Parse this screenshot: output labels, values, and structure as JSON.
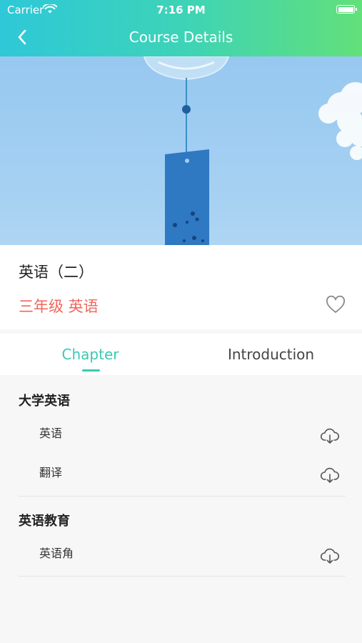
{
  "status_bar": {
    "carrier": "Carrier",
    "time": "7:16 PM"
  },
  "nav": {
    "title": "Course Details"
  },
  "course": {
    "title": "英语（二）",
    "subtitle": "三年级 英语"
  },
  "tabs": [
    {
      "label": "Chapter",
      "active": true
    },
    {
      "label": "Introduction",
      "active": false
    }
  ],
  "chapters": [
    {
      "title": "大学英语",
      "lessons": [
        {
          "title": "英语"
        },
        {
          "title": "翻译"
        }
      ]
    },
    {
      "title": "英语教育",
      "lessons": [
        {
          "title": "英语角"
        }
      ]
    }
  ],
  "colors": {
    "header_gradient": [
      "#2ec8d8",
      "#62e07a"
    ],
    "accent": "#3ac9b3",
    "subtitle_red": "#f0665c"
  },
  "icons": {
    "back": "chevron-left-icon",
    "favorite": "heart-outline-icon",
    "download": "cloud-download-icon",
    "wifi": "wifi-icon",
    "battery": "battery-icon"
  }
}
